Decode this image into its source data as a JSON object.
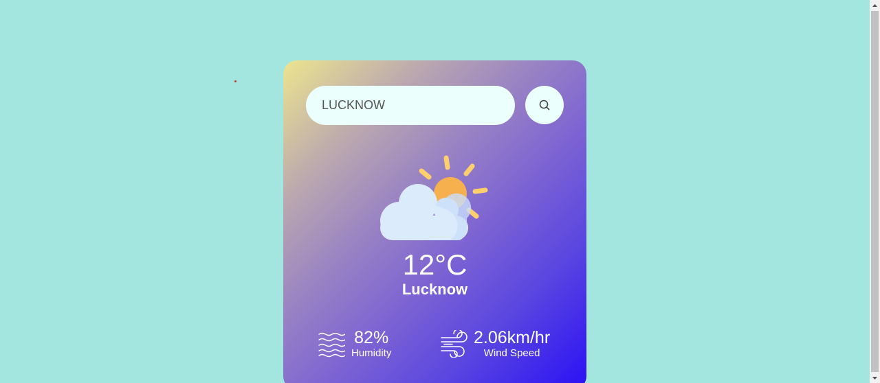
{
  "search": {
    "value": "LUCKNOW",
    "icon": "search-icon"
  },
  "weather": {
    "icon": "partly-cloudy-icon",
    "temperature": "12°C",
    "city": "Lucknow"
  },
  "stats": {
    "humidity": {
      "icon": "humidity-waves-icon",
      "value": "82%",
      "label": "Humidity"
    },
    "wind": {
      "icon": "wind-icon",
      "value": "2.06km/hr",
      "label": "Wind Speed"
    }
  },
  "colors": {
    "page_background": "#a3e6df",
    "card_gradient_start": "#ede58f",
    "card_gradient_end": "#2a10f5",
    "input_background": "#ebfffc",
    "sun": "#f6b04e",
    "sun_rays": "#ffcf6e",
    "cloud": "#dcebfb"
  }
}
